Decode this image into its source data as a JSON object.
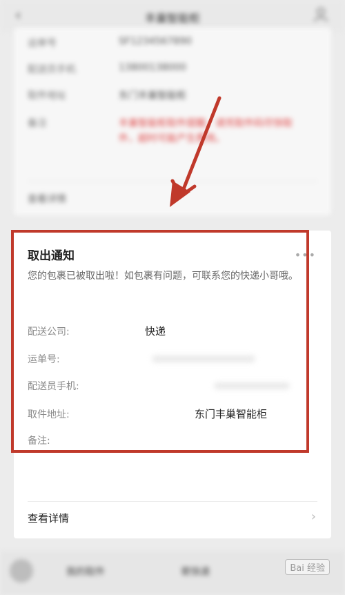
{
  "nav": {
    "title": "丰巢智能柜"
  },
  "top_card": {
    "rows": [
      {
        "label": "运单号",
        "value": "SF1234567890"
      },
      {
        "label": "配送员手机",
        "value": "13800138000"
      },
      {
        "label": "取件地址",
        "value": "东门丰巢智能柜"
      },
      {
        "label": "备注",
        "value": "丰巢智能柜取件提醒，请凭取件码尽快取件，超时可能产生费用。"
      }
    ],
    "detail_label": "查看详情"
  },
  "notice": {
    "title": "取出通知",
    "description": "您的包裹已被取出啦！如包裹有问题，可联系您的快递小哥哦。",
    "fields": [
      {
        "label": "配送公司:",
        "value": "快递"
      },
      {
        "label": "运单号:",
        "value": ""
      },
      {
        "label": "配送员手机:",
        "value": ""
      },
      {
        "label": "取件地址:",
        "value": "东门丰巢智能柜"
      },
      {
        "label": "备注:",
        "value": ""
      }
    ],
    "view_detail": "查看详情"
  },
  "bottom": {
    "btn1": "我的取件",
    "btn2": "寄快递",
    "watermark": "Bai 经验"
  },
  "colors": {
    "highlight_border": "#c0392b",
    "arrow": "#c0392b",
    "red_text": "#e04a4a"
  }
}
